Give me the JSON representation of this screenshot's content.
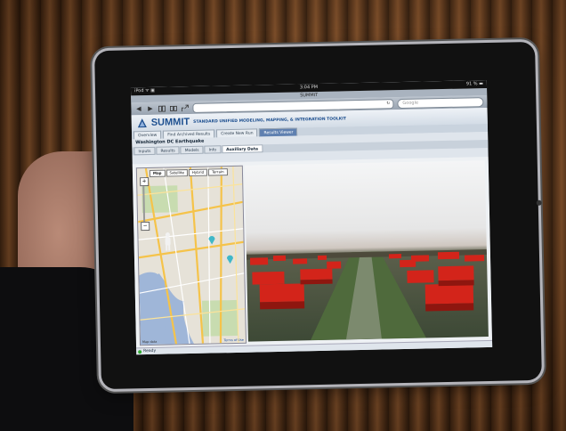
{
  "ios": {
    "carrier": "iPod ᯤ ▣",
    "time": "3:04 PM",
    "battery": "91 % ▬",
    "page_title": "SUMMIT"
  },
  "browser": {
    "back": "◀",
    "forward": "▶",
    "address": "",
    "search_placeholder": "Google"
  },
  "app": {
    "name": "SUMMIT",
    "subtitle": "STANDARD UNIFIED MODELING, MAPPING, & INTEGRATION TOOLKIT",
    "tabs": [
      "Overview",
      "Find Archived Results",
      "Create New Run",
      "Results Viewer"
    ],
    "active_tab": 3,
    "project_title": "Washington DC Earthquake",
    "subtabs": [
      "Inputs",
      "Results",
      "Models",
      "Info",
      "Auxiliary Data"
    ],
    "active_subtab": 4
  },
  "map": {
    "types": [
      "Map",
      "Satellite",
      "Hybrid",
      "Terrain"
    ],
    "active_type": 0,
    "zoom_in": "+",
    "zoom_out": "−",
    "attribution": "Map data",
    "terms_link": "Terms of Use"
  },
  "status": {
    "text": "Ready"
  },
  "colors": {
    "accent": "#1d4f8f",
    "active_tab": "#5f80b0",
    "building_red": "#d3241a",
    "pin_teal": "#3fb7c8"
  }
}
